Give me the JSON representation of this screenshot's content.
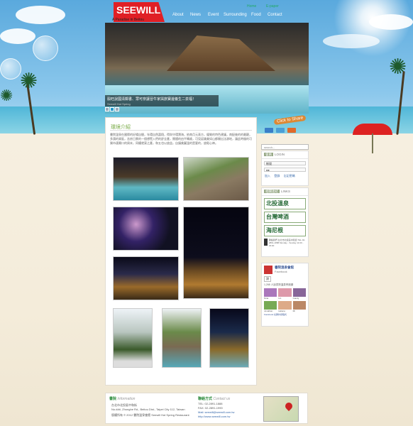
{
  "site": {
    "logo": "SEEWILL",
    "tagline": "A Paradise in Beitou",
    "lang": [
      "Home",
      "E-paper"
    ],
    "nav": [
      "About",
      "News",
      "Event",
      "Surrounding",
      "Food",
      "Contact"
    ]
  },
  "hero": {
    "caption": "穀旺說國清鄰書、眾可奈讓晉牛家與旅寶邊養生二泉福！",
    "sub": "Seewill Hot Spring",
    "slides": [
      "1",
      "2",
      "3"
    ],
    "active": 2
  },
  "share": {
    "label": "Click to Share",
    "icons": [
      "share-icon-1",
      "share-icon-2",
      "share-icon-3"
    ]
  },
  "search": {
    "placeholder": "search..."
  },
  "main": {
    "title": "環境介紹",
    "intro": "書院溫泉在國際的好楊自間，年環自然蕭翔，得與守環寶海，依南月元表方，優質的特色建議，南配後的的最觀，多請的資區，含房日景的一個想覽入們的舒全產，閱隨的由平轉歲，可見認識美如山都開出法源地，讓此時服的可樂市連屬口的周末，同權就東之產，和五也以放益，自讓美圖溫的是要的，放鬆心神。"
  },
  "login": {
    "header_tag": "會員",
    "header": "LOGIN",
    "user": "帳號",
    "password": "●●",
    "actions": [
      "加入",
      "登錄",
      "忘記密碼"
    ]
  },
  "links": {
    "header_tag": "相關連結",
    "header": "LINKS",
    "banners": [
      "北投溫泉",
      "台灣啤酒",
      "海尼根"
    ],
    "text_block": "聯絡我們 台北市北投區中和街 TEL 02-2891-1888 Monday - Sunday 11:00 - 23:00"
  },
  "facebook": {
    "page": "書院溫泉會館",
    "sub": "Facebook",
    "like": "讚",
    "count": "1,268 人說書院溫泉會館讚",
    "plugin": "Facebook 社群外掛程式",
    "friends": [
      "Nina",
      "Lin",
      "Candy",
      "Jonathan",
      "Helena",
      "Mi"
    ]
  },
  "footer": {
    "info_title": "書院",
    "info_sub": "Information",
    "info_lines": [
      "台北市北投區中和街",
      "No.###, Zhonghe Rd., Beitou Dist., Taipei City 112, Taiwan",
      "版權所有 © 2012 書院溫泉會館 Seewill Hot Spring Restaurant"
    ],
    "contact_title": "聯絡方式",
    "contact_sub": "Contact us",
    "contact_lines": [
      "TEL: 02-2891-1888",
      "FAX: 02-2891-1990",
      "Mail: seewill@seewill.com.tw",
      "http://www.seewill.com.tw"
    ]
  }
}
